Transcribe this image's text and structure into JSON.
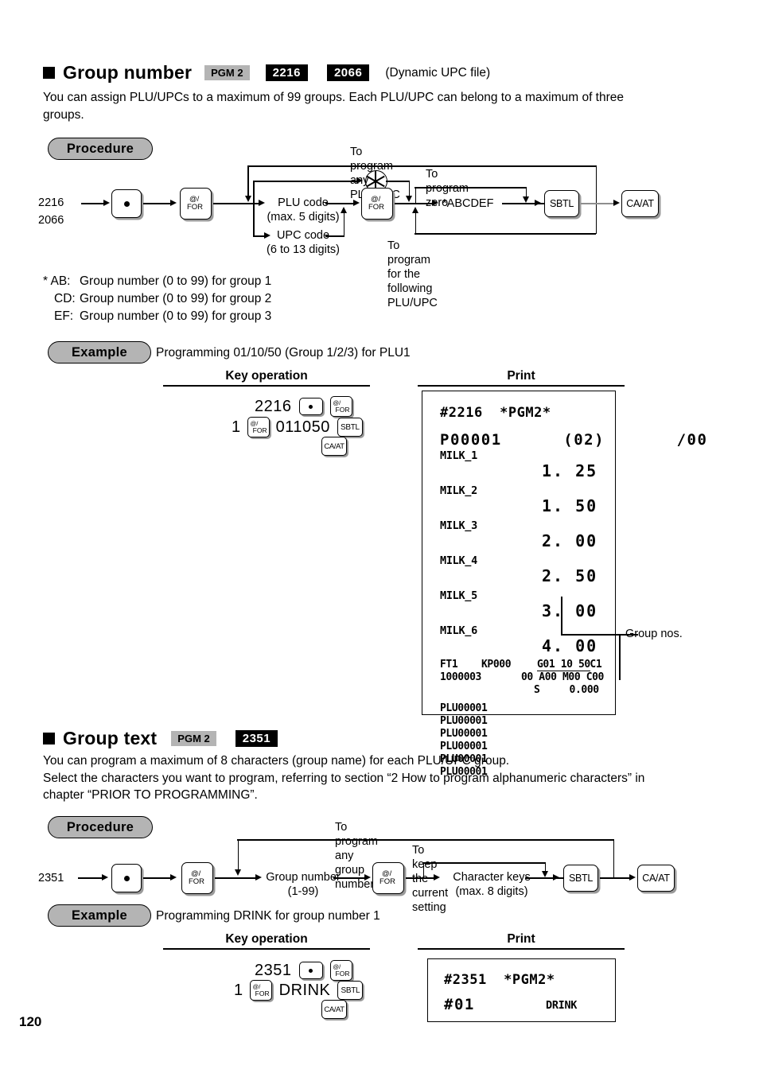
{
  "page": {
    "number": "120"
  },
  "section1": {
    "title": "Group number",
    "tag_mode": "PGM 2",
    "tag_code1": "2216",
    "tag_code2": "2066",
    "note": "(Dynamic UPC file)",
    "description_line1": "You can assign PLU/UPCs to a maximum of 99 groups. Each PLU/UPC can belong to a maximum of three",
    "description_line2": "groups.",
    "procedure_label": "Procedure",
    "flow": {
      "start_line1": "2216",
      "start_line2": "2066",
      "key_dot": "●",
      "key_for_at": "@/",
      "key_for_for": "FOR",
      "branch_top_label": "To program any PLU/UPC",
      "branch_zero_label": "To program zero",
      "branch_follow_label": "To program for the following PLU/UPC",
      "node_plu_line1": "PLU code",
      "node_plu_line2": "(max. 5 digits)",
      "node_upc_line1": "UPC code",
      "node_upc_line2": "(6 to 13 digits)",
      "node_abcdef": "*ABCDEF",
      "key_sbtl": "SBTL",
      "key_caat": "CA/AT",
      "multiply_icon": "circled-multiply-icon"
    },
    "legend": [
      {
        "code": "* AB:",
        "text": "Group number (0 to 99) for group 1"
      },
      {
        "code": "CD:",
        "text": "Group number (0 to 99) for group 2"
      },
      {
        "code": "EF:",
        "text": "Group number (0 to 99) for group 3"
      }
    ],
    "example_label": "Example",
    "example_text": "Programming 01/10/50 (Group 1/2/3) for PLU1",
    "col_keyop": "Key operation",
    "col_print": "Print",
    "key_operation": {
      "row1_num": "2216",
      "row1_dot": "●",
      "row2_lead": "1",
      "row2_num": "011050",
      "key_for_at": "@/",
      "key_for_for": "FOR",
      "key_sbtl": "SBTL",
      "key_caat": "CA/AT"
    },
    "receipt": {
      "header": "#2216  *PGM2*",
      "plu_line": "P00001      (02)       /00",
      "items": [
        {
          "name": "MILK_1",
          "price": "1. 25"
        },
        {
          "name": "MILK_2",
          "price": "1. 50"
        },
        {
          "name": "MILK_3",
          "price": "2. 00"
        },
        {
          "name": "MILK_4",
          "price": "2. 50"
        },
        {
          "name": "MILK_5",
          "price": "3. 00"
        },
        {
          "name": "MILK_6",
          "price": "4. 00"
        }
      ],
      "ft_left": "FT1    KP000",
      "ft_right_g": "G01 10 50",
      "ft_right_c": " C1",
      "code_left": "1000003",
      "code_right": "00 A00 M00 C00",
      "s_line": "S     0.000",
      "plu_repeat": [
        "PLU00001",
        "PLU00001",
        "PLU00001",
        "PLU00001",
        "PLU00001",
        "PLU00001"
      ]
    },
    "callout": "Group nos."
  },
  "section2": {
    "title": "Group text",
    "tag_mode": "PGM 2",
    "tag_code1": "2351",
    "description_line1": "You can program a maximum of 8 characters (group name) for each PLU/UPC group.",
    "description_line2": "Select the characters you want to program, referring to section “2  How to program alphanumeric characters” in",
    "description_line3": "chapter “PRIOR TO PROGRAMMING”.",
    "procedure_label": "Procedure",
    "flow": {
      "start": "2351",
      "key_dot": "●",
      "key_for_at": "@/",
      "key_for_for": "FOR",
      "branch_top_label": "To program any group number",
      "branch_keep_label": "To keep the current setting",
      "node_group_line1": "Group number",
      "node_group_line2": "(1-99)",
      "node_char_line1": "Character keys",
      "node_char_line2": "(max. 8 digits)",
      "key_sbtl": "SBTL",
      "key_caat": "CA/AT"
    },
    "example_label": "Example",
    "example_text": "Programming DRINK for group number 1",
    "col_keyop": "Key operation",
    "col_print": "Print",
    "key_operation": {
      "row1_num": "2351",
      "row1_dot": "●",
      "row2_lead": "1",
      "row2_text": "DRINK",
      "key_for_at": "@/",
      "key_for_for": "FOR",
      "key_sbtl": "SBTL",
      "key_caat": "CA/AT"
    },
    "receipt": {
      "header": "#2351  *PGM2*",
      "line_left": "#01",
      "line_right": "DRINK"
    }
  }
}
